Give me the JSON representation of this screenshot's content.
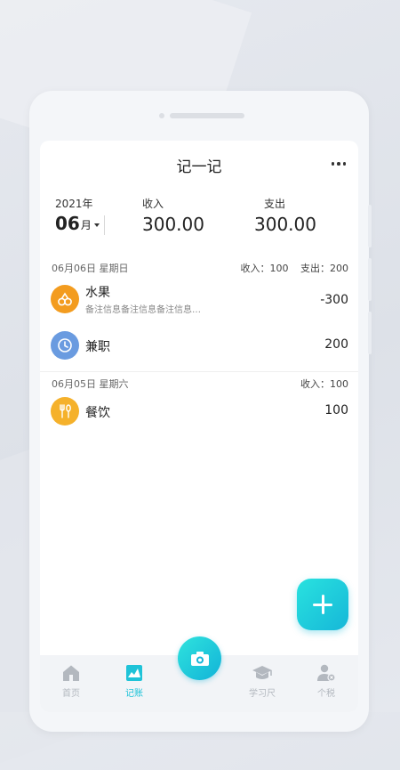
{
  "header": {
    "title": "记一记"
  },
  "summary": {
    "year": "2021年",
    "month_num": "06",
    "month_unit": "月",
    "income_label": "收入",
    "income_value": "300.00",
    "expense_label": "支出",
    "expense_value": "300.00"
  },
  "days": [
    {
      "date": "06月06日   星期日",
      "income": "收入：100",
      "expense": "支出：200",
      "entries": [
        {
          "name": "水果",
          "note": "备注信息备注信息备注信息…",
          "amount": "-300",
          "icon": "fruit-icon",
          "color": "#f39c1f"
        },
        {
          "name": "兼职",
          "note": "",
          "amount": "200",
          "icon": "clock-icon",
          "color": "#6a9be0"
        }
      ]
    },
    {
      "date": "06月05日   星期六",
      "income": "收入：100",
      "entries": [
        {
          "name": "餐饮",
          "note": "",
          "amount": "100",
          "icon": "utensils-icon",
          "color": "#f5b12b"
        }
      ]
    }
  ],
  "tabbar": {
    "items": [
      {
        "label": "首页",
        "icon": "home-icon",
        "active": false
      },
      {
        "label": "记账",
        "icon": "ledger-icon",
        "active": true
      },
      {
        "label": "学习尺",
        "icon": "graduation-cap-icon",
        "active": false
      },
      {
        "label": "个税",
        "icon": "user-tax-icon",
        "active": false
      }
    ],
    "camera_icon": "camera-icon"
  },
  "colors": {
    "accent": "#1fc3d8",
    "inactive_tab": "#b3b8bf"
  }
}
